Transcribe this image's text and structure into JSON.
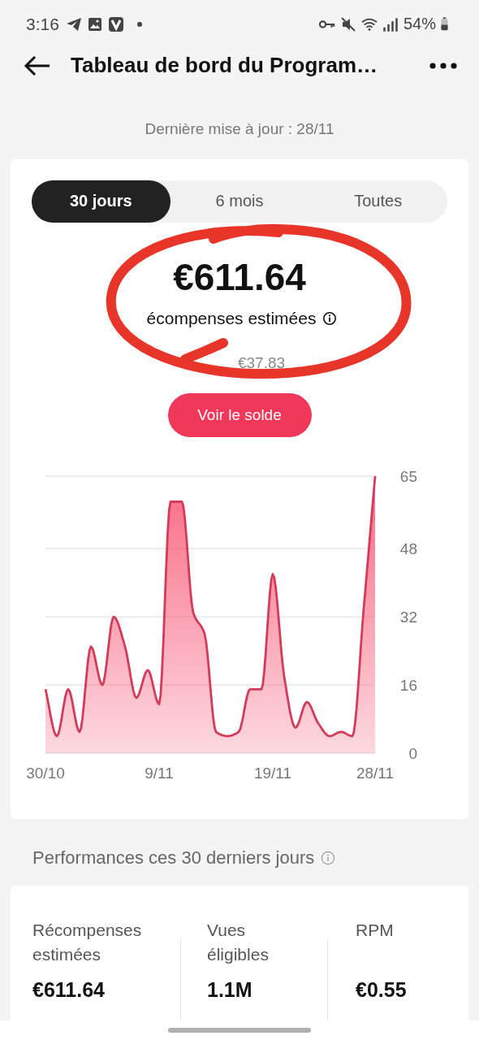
{
  "status_bar": {
    "time": "3:16",
    "battery": "54%"
  },
  "header": {
    "title": "Tableau de bord du Program…"
  },
  "updated": "Dernière mise à jour : 28/11",
  "tabs": [
    {
      "label": "30 jours",
      "selected": true
    },
    {
      "label": "6 mois",
      "selected": false
    },
    {
      "label": "Toutes",
      "selected": false
    }
  ],
  "amount": "€611.64",
  "amount_label": "écompenses estimées",
  "yesterday": "€37.83",
  "balance_button": "Voir le solde",
  "markup_circle": true,
  "chart_data": {
    "type": "area",
    "categories": [
      "30/10",
      null,
      null,
      null,
      null,
      null,
      null,
      null,
      null,
      null,
      "9/11",
      null,
      null,
      null,
      null,
      null,
      null,
      null,
      null,
      null,
      "19/11",
      null,
      null,
      null,
      null,
      null,
      null,
      null,
      null,
      "28/11"
    ],
    "grid": true,
    "series": [
      {
        "color": "#d23b5a",
        "values": [
          15,
          4,
          15,
          5,
          25,
          16,
          32,
          25,
          13,
          19.5,
          11.5,
          59,
          59,
          33,
          28,
          5,
          4,
          5,
          15,
          15,
          42,
          18,
          6,
          12,
          7,
          4,
          5,
          4,
          34,
          65
        ]
      }
    ],
    "ylim": [
      0,
      65
    ],
    "yticks": [
      0,
      16,
      32,
      48,
      65
    ]
  },
  "performance_title": "Performances ces 30 derniers jours",
  "stats": [
    {
      "label": "Récompenses estimées",
      "value": "€611.64"
    },
    {
      "label": "Vues éligibles",
      "value": "1.1M"
    },
    {
      "label": "RPM",
      "value": "€0.55"
    }
  ]
}
